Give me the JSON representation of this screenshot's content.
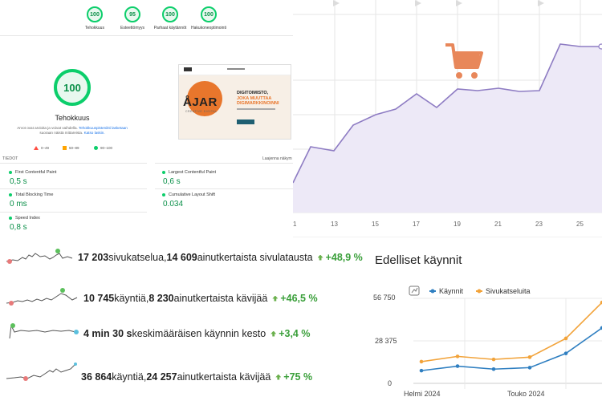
{
  "lighthouse": {
    "categories": [
      {
        "score": "100",
        "label": "Tehokkuus"
      },
      {
        "score": "95",
        "label": "Esteettömyys"
      },
      {
        "score": "100",
        "label": "Parhaat käytännöt"
      },
      {
        "score": "100",
        "label": "Hakukoneoptimointi"
      }
    ],
    "main_score": "100",
    "main_title": "Tehokkuus",
    "desc_prefix": "Arvot ovat arvioita ja voivat vaihdella.",
    "desc_link1": "Tehokkuuspisteniitti lasketaan",
    "desc_mid": "suoraan näistä mittareista.",
    "desc_link2": "Katso laskin.",
    "legend": {
      "bad": "0–49",
      "avg": "50–89",
      "good": "90–100"
    },
    "metrics_label": "TIEDOT",
    "expand_label": "Laajenna näkym",
    "metrics": [
      {
        "name": "First Contentful Paint",
        "value": "0,5 s"
      },
      {
        "name": "Largest Contentful Paint",
        "value": "0,6 s"
      },
      {
        "name": "Total Blocking Time",
        "value": "0 ms"
      },
      {
        "name": "Cumulative Layout Shift",
        "value": "0.034"
      },
      {
        "name": "Speed Index",
        "value": "0,8 s"
      }
    ],
    "screenshot": {
      "brand": "ÅJAR",
      "brand_sub": "CREATIVE DIGITAL",
      "headline1": "DIGITOIMISTO,",
      "headline2": "JOKA MUUTTAA",
      "headline3": "DIGIMARKKINOINNI",
      "accent": "#e8762c"
    }
  },
  "top_chart": {
    "icon": "shopping-cart-icon",
    "icon_color": "#e8875a",
    "line_color": "#8e7cc3",
    "fill_color": "#ede9f7",
    "x_ticks": [
      "1",
      "13",
      "15",
      "17",
      "19",
      "21",
      "23",
      "25"
    ]
  },
  "stats": [
    {
      "n1": "17 203",
      "t1": " sivukatselua, ",
      "n2": "14 609",
      "t2": " ainutkertaista sivulatausta",
      "change": "+48,9 %"
    },
    {
      "n1": "10 745",
      "t1": " käyntiä, ",
      "n2": "8 230",
      "t2": " ainutkertaista kävijää",
      "change": "+46,5 %"
    },
    {
      "n1": "4 min 30 s",
      "t1": " keskimääräisen käynnin kesto",
      "n2": "",
      "t2": "",
      "change": "+3,4 %"
    },
    {
      "n1": "36 864",
      "t1": " käyntiä, ",
      "n2": "24 257",
      "t2": " ainutkertaista kävijää",
      "change": "+75 %"
    }
  ],
  "prev_visits": {
    "title": "Edelliset käynnit",
    "series1": "Käynnit",
    "series2": "Sivukatseluita",
    "color1": "#2f7fc1",
    "color2": "#f2a33a",
    "y_ticks": [
      "56 750",
      "28 375",
      "0"
    ],
    "x_ticks": [
      "Helmi 2024",
      "Touko 2024"
    ]
  },
  "chart_data": {
    "type": "line",
    "x": [
      "Helmi 2024",
      "",
      "",
      "",
      "Touko 2024",
      "",
      ""
    ],
    "ylim": [
      0,
      56750
    ],
    "series": [
      {
        "name": "Käynnit",
        "values": [
          8500,
          11500,
          9500,
          10500,
          20000,
          37000
        ]
      },
      {
        "name": "Sivukatseluita",
        "values": [
          14500,
          18000,
          16000,
          17500,
          30000,
          54000
        ]
      }
    ]
  }
}
